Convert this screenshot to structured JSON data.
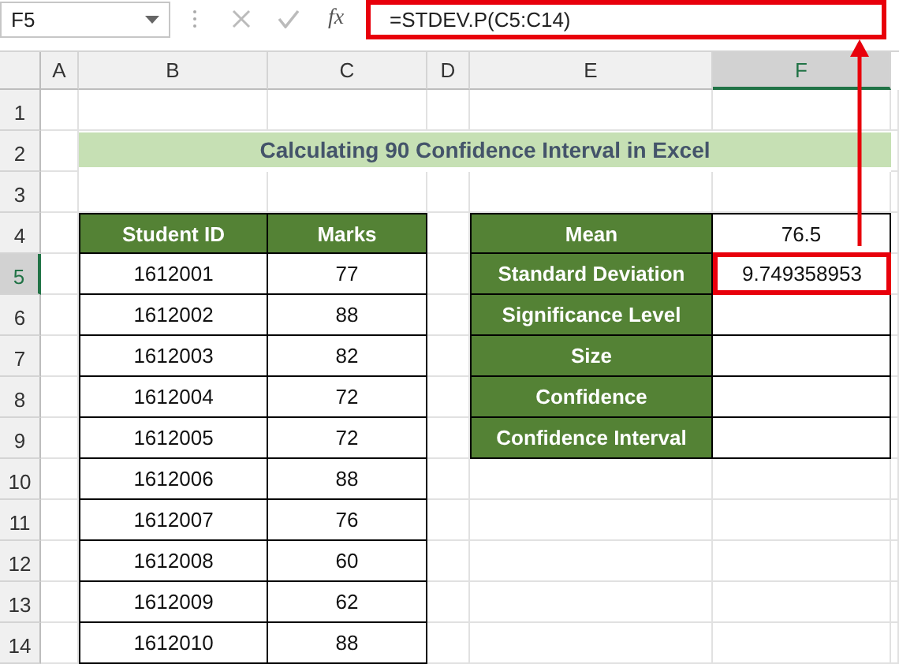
{
  "formula_bar": {
    "name_box": "F5",
    "function_label": "fx",
    "formula": "=STDEV.P(C5:C14)",
    "highlighted": true
  },
  "columns": [
    {
      "label": "A",
      "selected": false
    },
    {
      "label": "B",
      "selected": false
    },
    {
      "label": "C",
      "selected": false
    },
    {
      "label": "D",
      "selected": false
    },
    {
      "label": "E",
      "selected": false
    },
    {
      "label": "F",
      "selected": true
    }
  ],
  "rows": [
    {
      "label": "1",
      "selected": false
    },
    {
      "label": "2",
      "selected": false
    },
    {
      "label": "3",
      "selected": false
    },
    {
      "label": "4",
      "selected": false
    },
    {
      "label": "5",
      "selected": true
    },
    {
      "label": "6",
      "selected": false
    },
    {
      "label": "7",
      "selected": false
    },
    {
      "label": "8",
      "selected": false
    },
    {
      "label": "9",
      "selected": false
    },
    {
      "label": "10",
      "selected": false
    },
    {
      "label": "11",
      "selected": false
    },
    {
      "label": "12",
      "selected": false
    },
    {
      "label": "13",
      "selected": false
    },
    {
      "label": "14",
      "selected": false
    }
  ],
  "title": "Calculating 90 Confidence Interval in Excel",
  "students_table": {
    "columns": [
      "Student ID",
      "Marks"
    ],
    "rows": [
      [
        "1612001",
        "77"
      ],
      [
        "1612002",
        "88"
      ],
      [
        "1612003",
        "82"
      ],
      [
        "1612004",
        "72"
      ],
      [
        "1612005",
        "72"
      ],
      [
        "1612006",
        "88"
      ],
      [
        "1612007",
        "76"
      ],
      [
        "1612008",
        "60"
      ],
      [
        "1612009",
        "62"
      ],
      [
        "1612010",
        "88"
      ]
    ]
  },
  "stats_table": [
    {
      "label": "Mean",
      "value": "76.5",
      "highlighted": false
    },
    {
      "label": "Standard Deviation",
      "value": "9.749358953",
      "highlighted": true
    },
    {
      "label": "Significance Level",
      "highlighted": false
    },
    {
      "label": "Size",
      "highlighted": false
    },
    {
      "label": "Confidence",
      "highlighted": false
    },
    {
      "label": "Confidence Interval",
      "highlighted": false
    }
  ],
  "callout_arrow": true
}
